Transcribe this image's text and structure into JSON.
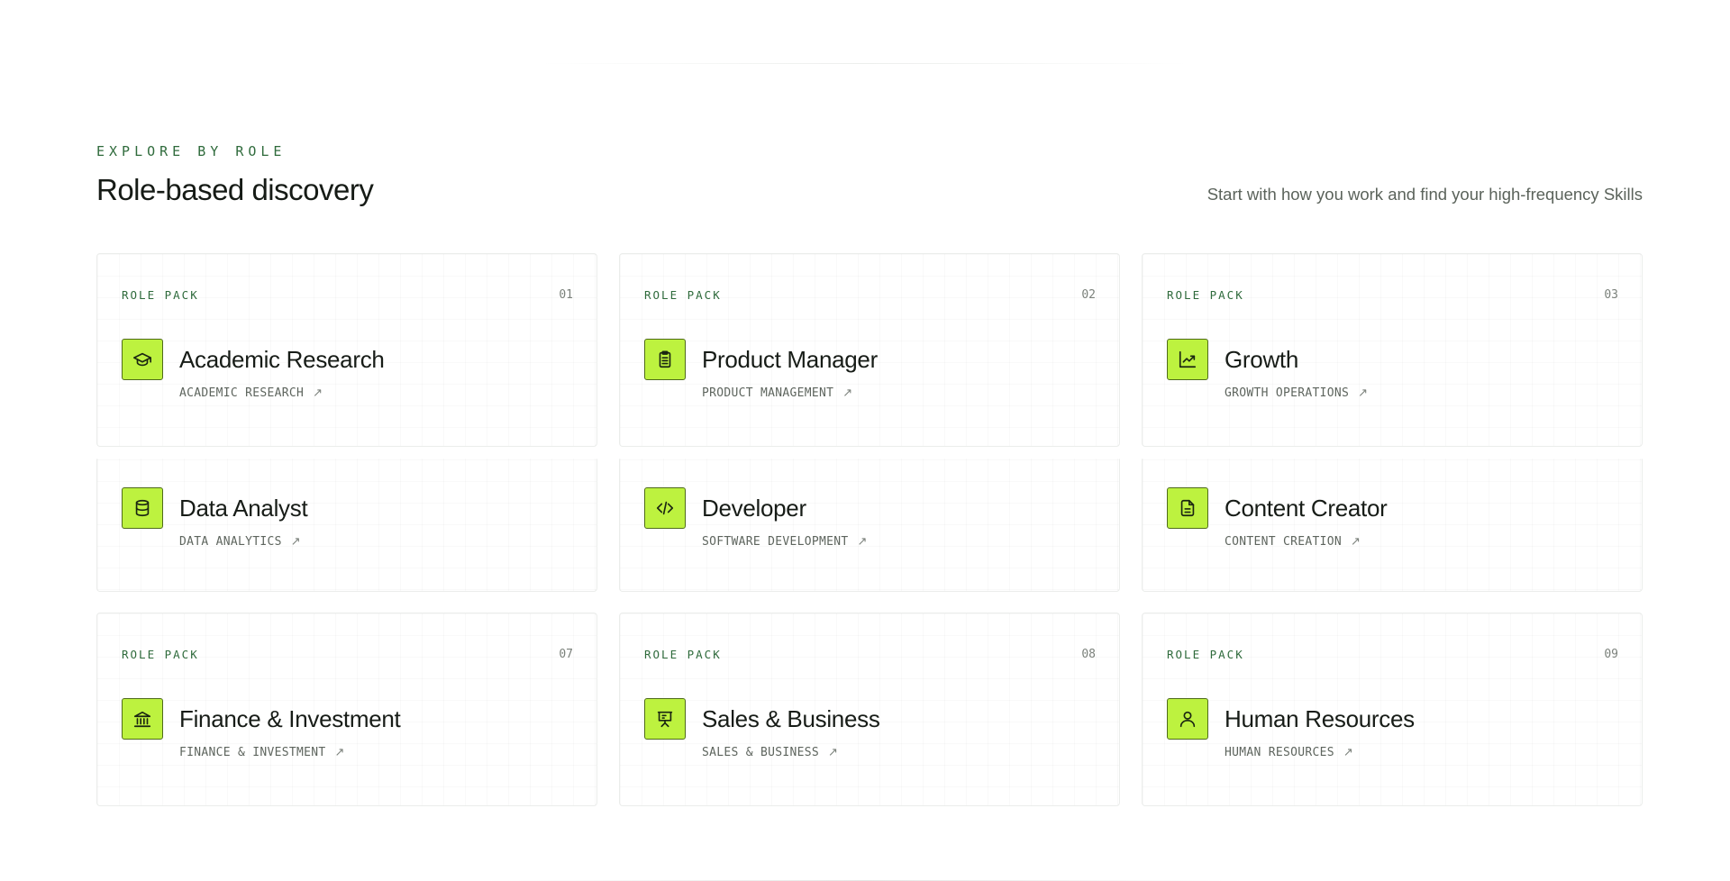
{
  "section": {
    "eyebrow": "EXPLORE BY ROLE",
    "title": "Role-based discovery",
    "subtitle": "Start with how you work and find your high-frequency Skills"
  },
  "colors": {
    "accent": "#bdf23f",
    "eyebrow": "#2f6b3c",
    "border": "#ebedeb"
  },
  "cards": [
    {
      "pack": "ROLE PACK",
      "number": "01",
      "title": "Academic Research",
      "subtitle": "ACADEMIC RESEARCH",
      "icon": "graduation-cap-icon",
      "arrow": "↗"
    },
    {
      "pack": "ROLE PACK",
      "number": "02",
      "title": "Product Manager",
      "subtitle": "PRODUCT MANAGEMENT",
      "icon": "clipboard-icon",
      "arrow": "↗"
    },
    {
      "pack": "ROLE PACK",
      "number": "03",
      "title": "Growth",
      "subtitle": "GROWTH OPERATIONS",
      "icon": "trending-up-chart-icon",
      "arrow": "↗"
    },
    {
      "title": "Data Analyst",
      "subtitle": "DATA ANALYTICS",
      "icon": "database-icon",
      "arrow": "↗"
    },
    {
      "title": "Developer",
      "subtitle": "SOFTWARE DEVELOPMENT",
      "icon": "code-icon",
      "arrow": "↗"
    },
    {
      "title": "Content Creator",
      "subtitle": "CONTENT CREATION",
      "icon": "document-icon",
      "arrow": "↗"
    },
    {
      "pack": "ROLE PACK",
      "number": "07",
      "title": "Finance & Investment",
      "subtitle": "FINANCE & INVESTMENT",
      "icon": "bank-icon",
      "arrow": "↗"
    },
    {
      "pack": "ROLE PACK",
      "number": "08",
      "title": "Sales & Business",
      "subtitle": "SALES & BUSINESS",
      "icon": "presentation-board-icon",
      "arrow": "↗"
    },
    {
      "pack": "ROLE PACK",
      "number": "09",
      "title": "Human Resources",
      "subtitle": "HUMAN RESOURCES",
      "icon": "user-icon",
      "arrow": "↗"
    }
  ]
}
